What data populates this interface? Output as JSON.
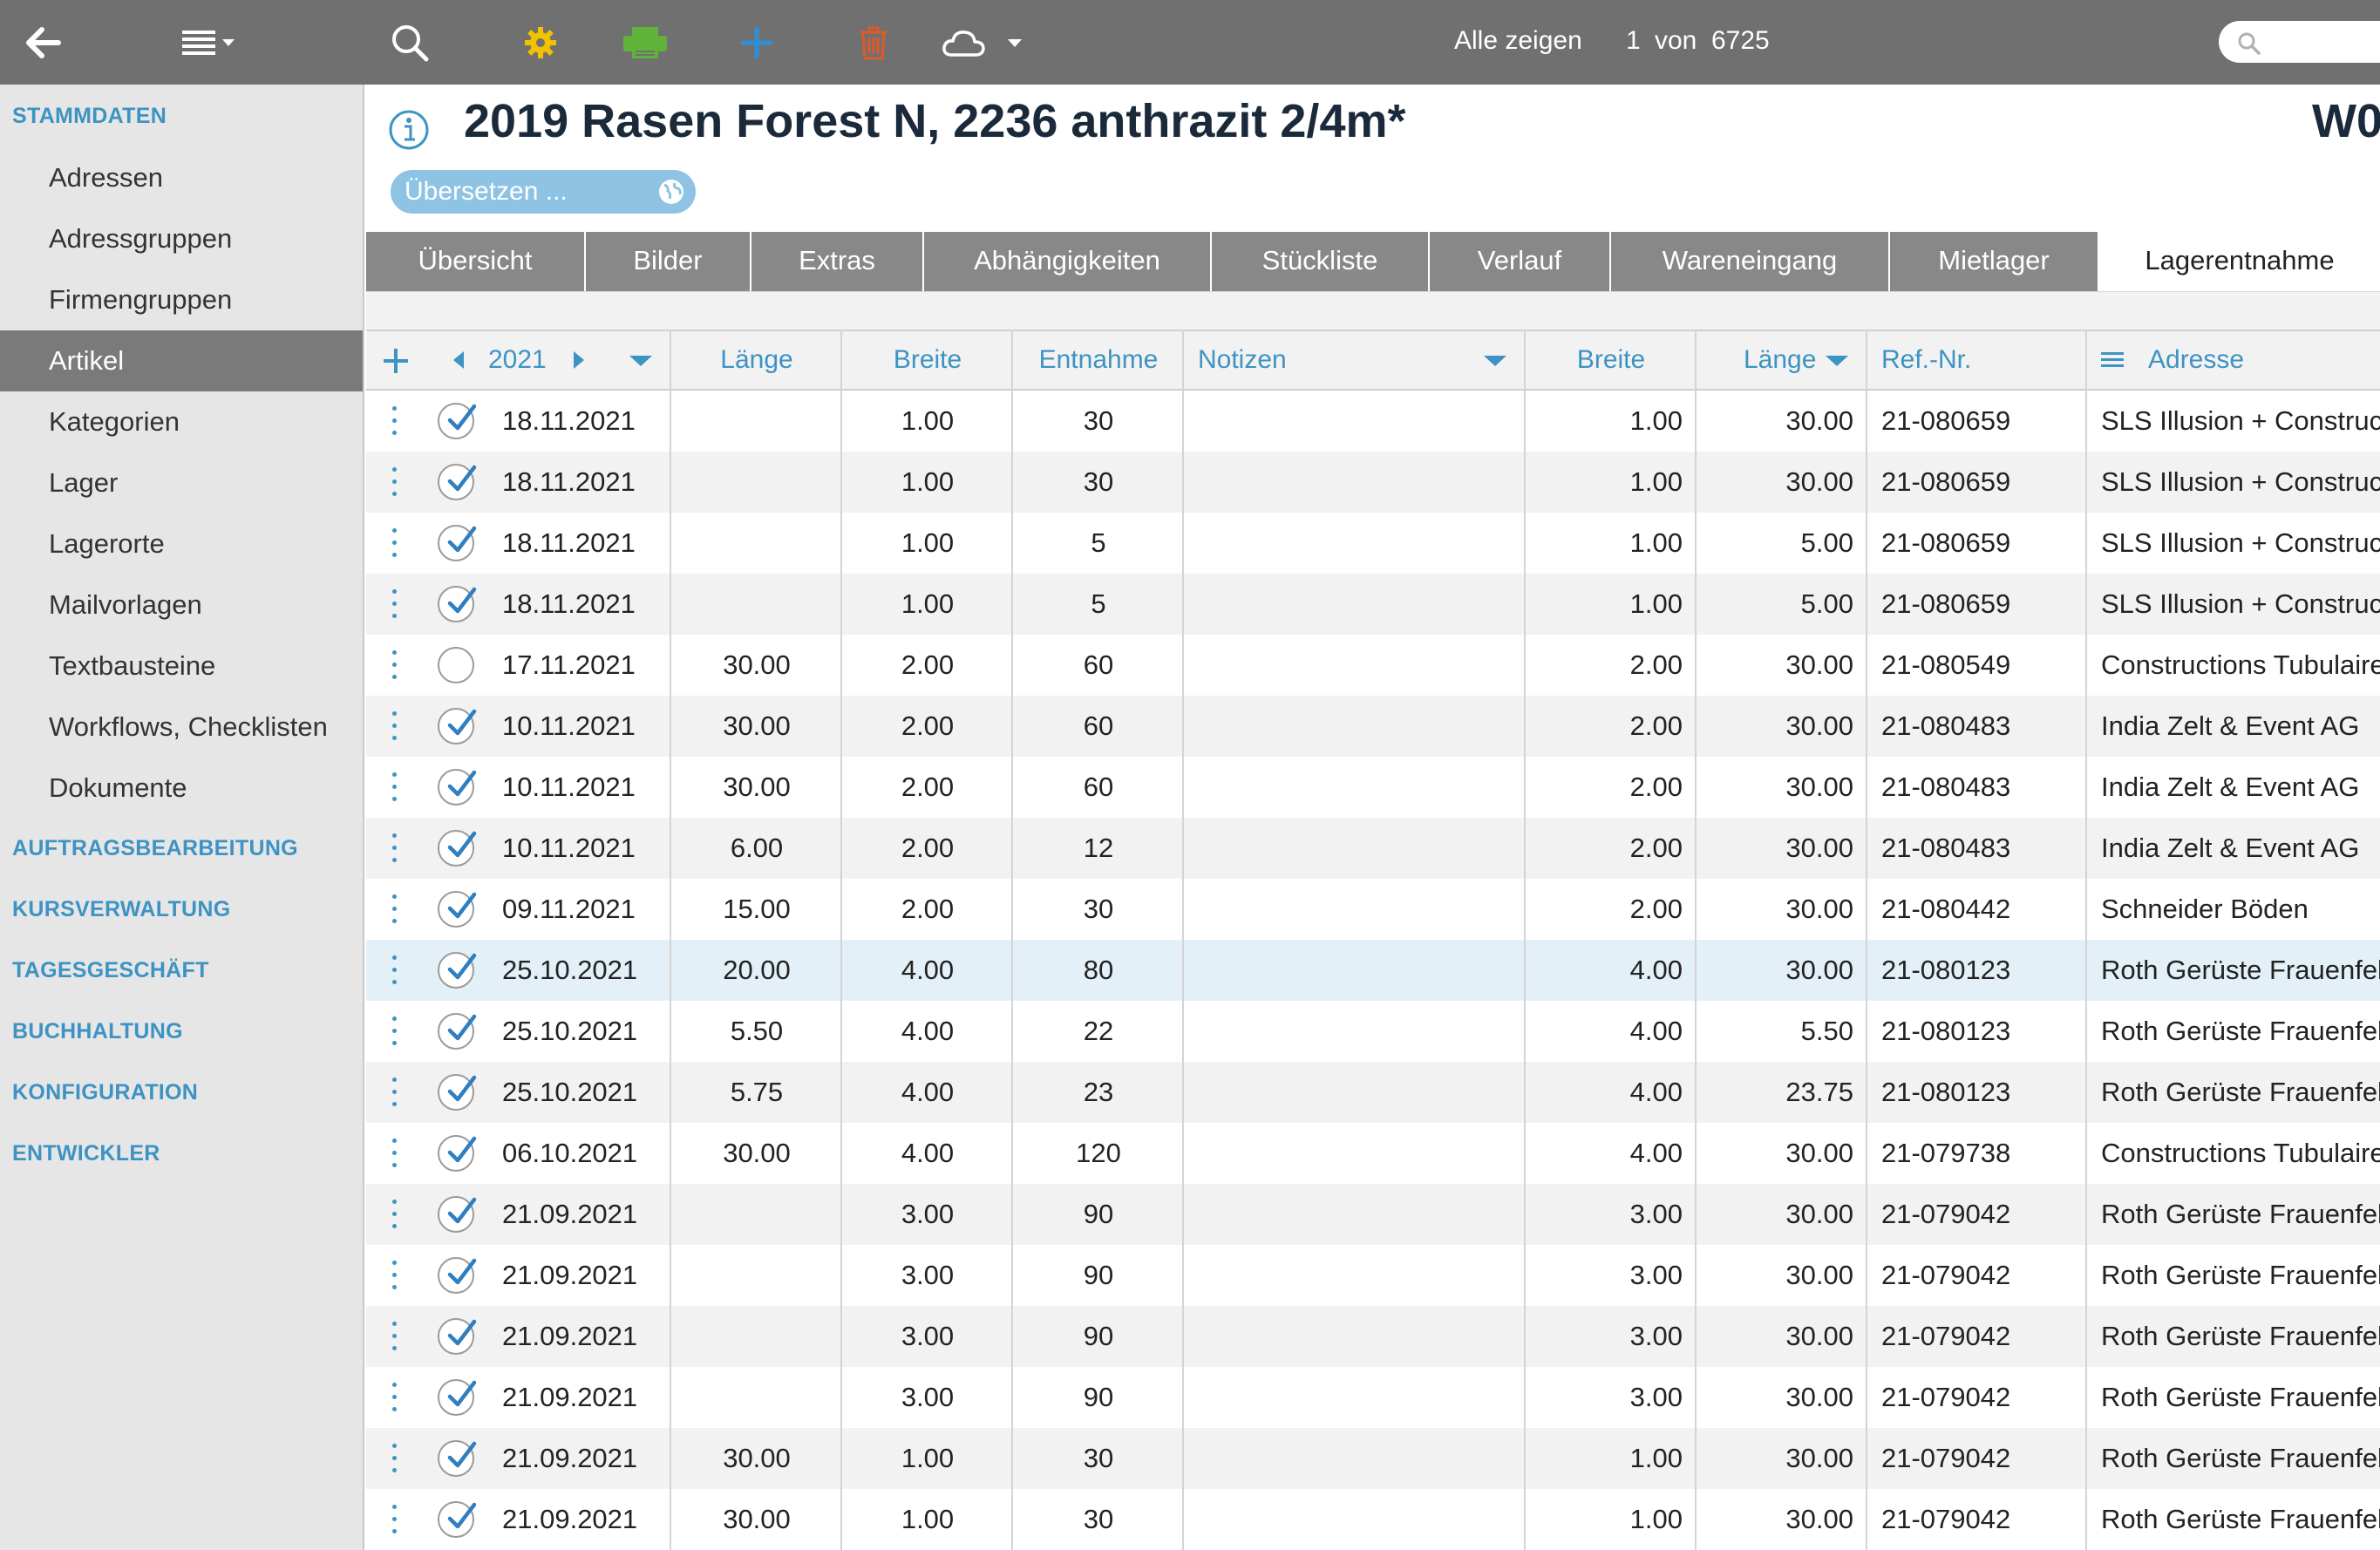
{
  "toolbar": {
    "show_all_label": "Alle zeigen",
    "record_index": "1",
    "of_label": "von",
    "record_total": "6725",
    "icons": [
      "back-arrow-icon",
      "menu-list-icon",
      "search-icon",
      "gear-icon",
      "print-icon",
      "plus-icon",
      "trash-icon",
      "cloud-icon"
    ],
    "colors": {
      "gear": "#f2c200",
      "print": "#5fb33a",
      "plus": "#2f8fd6",
      "trash": "#de5a2b"
    }
  },
  "sidebar": {
    "sections": [
      {
        "label": "STAMMDATEN"
      },
      {
        "label": "AUFTRAGSBEARBEITUNG"
      },
      {
        "label": "KURSVERWALTUNG"
      },
      {
        "label": "TAGESGESCHÄFT"
      },
      {
        "label": "BUCHHALTUNG"
      },
      {
        "label": "KONFIGURATION"
      },
      {
        "label": "ENTWICKLER"
      }
    ],
    "items": [
      {
        "label": "Adressen"
      },
      {
        "label": "Adressgruppen"
      },
      {
        "label": "Firmengruppen"
      },
      {
        "label": "Artikel",
        "active": true
      },
      {
        "label": "Kategorien"
      },
      {
        "label": "Lager"
      },
      {
        "label": "Lagerorte"
      },
      {
        "label": "Mailvorlagen"
      },
      {
        "label": "Textbausteine"
      },
      {
        "label": "Workflows, Checklisten"
      },
      {
        "label": "Dokumente"
      }
    ]
  },
  "header": {
    "title": "2019 Rasen Forest N, 2236 anthrazit 2/4m*",
    "code": "W0",
    "translate_label": "Übersetzen ..."
  },
  "tabs": [
    {
      "label": "Übersicht"
    },
    {
      "label": "Bilder"
    },
    {
      "label": "Extras"
    },
    {
      "label": "Abhängigkeiten"
    },
    {
      "label": "Stückliste"
    },
    {
      "label": "Verlauf"
    },
    {
      "label": "Wareneingang"
    },
    {
      "label": "Mietlager"
    },
    {
      "label": "Lagerentnahme",
      "active": true
    }
  ],
  "table": {
    "year": "2021",
    "columns": {
      "laenge": "Länge",
      "breite": "Breite",
      "entnahme": "Entnahme",
      "notizen": "Notizen",
      "breite2": "Breite",
      "laenge2": "Länge",
      "ref": "Ref.-Nr.",
      "adresse": "Adresse"
    },
    "rows": [
      {
        "checked": true,
        "date": "18.11.2021",
        "laenge": "",
        "breite": "1.00",
        "entnahme": "30",
        "notizen": "",
        "breite2": "1.00",
        "laenge2": "30.00",
        "ref": "21-080659",
        "adresse": "SLS Illusion + Construction"
      },
      {
        "checked": true,
        "date": "18.11.2021",
        "laenge": "",
        "breite": "1.00",
        "entnahme": "30",
        "notizen": "",
        "breite2": "1.00",
        "laenge2": "30.00",
        "ref": "21-080659",
        "adresse": "SLS Illusion + Construction"
      },
      {
        "checked": true,
        "date": "18.11.2021",
        "laenge": "",
        "breite": "1.00",
        "entnahme": "5",
        "notizen": "",
        "breite2": "1.00",
        "laenge2": "5.00",
        "ref": "21-080659",
        "adresse": "SLS Illusion + Construction"
      },
      {
        "checked": true,
        "date": "18.11.2021",
        "laenge": "",
        "breite": "1.00",
        "entnahme": "5",
        "notizen": "",
        "breite2": "1.00",
        "laenge2": "5.00",
        "ref": "21-080659",
        "adresse": "SLS Illusion + Construction"
      },
      {
        "checked": false,
        "date": "17.11.2021",
        "laenge": "30.00",
        "breite": "2.00",
        "entnahme": "60",
        "notizen": "",
        "breite2": "2.00",
        "laenge2": "30.00",
        "ref": "21-080549",
        "adresse": "Constructions Tubulaires"
      },
      {
        "checked": true,
        "date": "10.11.2021",
        "laenge": "30.00",
        "breite": "2.00",
        "entnahme": "60",
        "notizen": "",
        "breite2": "2.00",
        "laenge2": "30.00",
        "ref": "21-080483",
        "adresse": "India Zelt & Event  AG"
      },
      {
        "checked": true,
        "date": "10.11.2021",
        "laenge": "30.00",
        "breite": "2.00",
        "entnahme": "60",
        "notizen": "",
        "breite2": "2.00",
        "laenge2": "30.00",
        "ref": "21-080483",
        "adresse": "India Zelt & Event  AG"
      },
      {
        "checked": true,
        "date": "10.11.2021",
        "laenge": "6.00",
        "breite": "2.00",
        "entnahme": "12",
        "notizen": "",
        "breite2": "2.00",
        "laenge2": "30.00",
        "ref": "21-080483",
        "adresse": "India Zelt & Event  AG"
      },
      {
        "checked": true,
        "date": "09.11.2021",
        "laenge": "15.00",
        "breite": "2.00",
        "entnahme": "30",
        "notizen": "",
        "breite2": "2.00",
        "laenge2": "30.00",
        "ref": "21-080442",
        "adresse": "Schneider Böden"
      },
      {
        "checked": true,
        "date": "25.10.2021",
        "laenge": "20.00",
        "breite": "4.00",
        "entnahme": "80",
        "notizen": "",
        "breite2": "4.00",
        "laenge2": "30.00",
        "ref": "21-080123",
        "adresse": "Roth Gerüste Frauenfeld",
        "highlight": true
      },
      {
        "checked": true,
        "date": "25.10.2021",
        "laenge": "5.50",
        "breite": "4.00",
        "entnahme": "22",
        "notizen": "",
        "breite2": "4.00",
        "laenge2": "5.50",
        "ref": "21-080123",
        "adresse": "Roth Gerüste Frauenfeld"
      },
      {
        "checked": true,
        "date": "25.10.2021",
        "laenge": "5.75",
        "breite": "4.00",
        "entnahme": "23",
        "notizen": "",
        "breite2": "4.00",
        "laenge2": "23.75",
        "ref": "21-080123",
        "adresse": "Roth Gerüste Frauenfeld"
      },
      {
        "checked": true,
        "date": "06.10.2021",
        "laenge": "30.00",
        "breite": "4.00",
        "entnahme": "120",
        "notizen": "",
        "breite2": "4.00",
        "laenge2": "30.00",
        "ref": "21-079738",
        "adresse": "Constructions Tubulaires"
      },
      {
        "checked": true,
        "date": "21.09.2021",
        "laenge": "",
        "breite": "3.00",
        "entnahme": "90",
        "notizen": "",
        "breite2": "3.00",
        "laenge2": "30.00",
        "ref": "21-079042",
        "adresse": "Roth Gerüste Frauenfeld"
      },
      {
        "checked": true,
        "date": "21.09.2021",
        "laenge": "",
        "breite": "3.00",
        "entnahme": "90",
        "notizen": "",
        "breite2": "3.00",
        "laenge2": "30.00",
        "ref": "21-079042",
        "adresse": "Roth Gerüste Frauenfeld"
      },
      {
        "checked": true,
        "date": "21.09.2021",
        "laenge": "",
        "breite": "3.00",
        "entnahme": "90",
        "notizen": "",
        "breite2": "3.00",
        "laenge2": "30.00",
        "ref": "21-079042",
        "adresse": "Roth Gerüste Frauenfeld"
      },
      {
        "checked": true,
        "date": "21.09.2021",
        "laenge": "",
        "breite": "3.00",
        "entnahme": "90",
        "notizen": "",
        "breite2": "3.00",
        "laenge2": "30.00",
        "ref": "21-079042",
        "adresse": "Roth Gerüste Frauenfeld"
      },
      {
        "checked": true,
        "date": "21.09.2021",
        "laenge": "30.00",
        "breite": "1.00",
        "entnahme": "30",
        "notizen": "",
        "breite2": "1.00",
        "laenge2": "30.00",
        "ref": "21-079042",
        "adresse": "Roth Gerüste Frauenfeld"
      },
      {
        "checked": true,
        "date": "21.09.2021",
        "laenge": "30.00",
        "breite": "1.00",
        "entnahme": "30",
        "notizen": "",
        "breite2": "1.00",
        "laenge2": "30.00",
        "ref": "21-079042",
        "adresse": "Roth Gerüste Frauenfeld"
      }
    ]
  }
}
